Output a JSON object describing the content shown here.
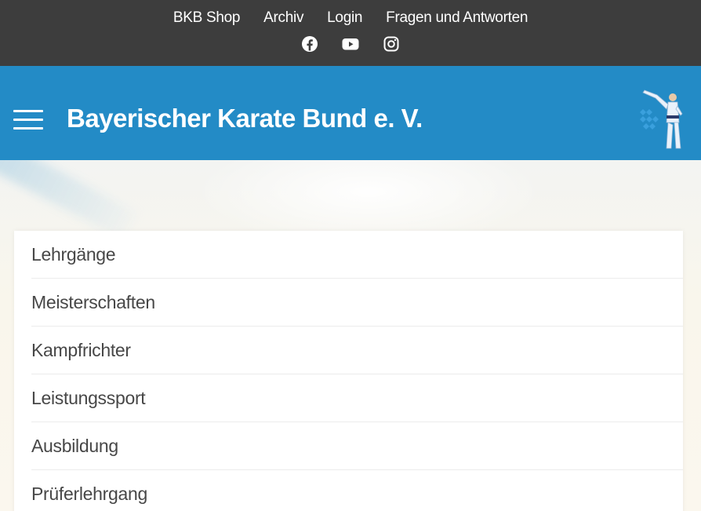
{
  "topbar": {
    "links": [
      "BKB Shop",
      "Archiv",
      "Login",
      "Fragen und Antworten"
    ],
    "social_icons": [
      "facebook-icon",
      "youtube-icon",
      "instagram-icon"
    ]
  },
  "header": {
    "title": "Bayerischer Karate Bund e. V.",
    "menu_icon": "hamburger-menu-icon",
    "logo": "karate-kick-logo",
    "background_color": "#238bc6"
  },
  "menu": {
    "items": [
      "Lehrgänge",
      "Meisterschaften",
      "Kampfrichter",
      "Leistungssport",
      "Ausbildung",
      "Prüferlehrgang"
    ]
  },
  "colors": {
    "topbar_bg": "#3d3d3d",
    "accent": "#238bc6",
    "menu_text": "#474747"
  }
}
